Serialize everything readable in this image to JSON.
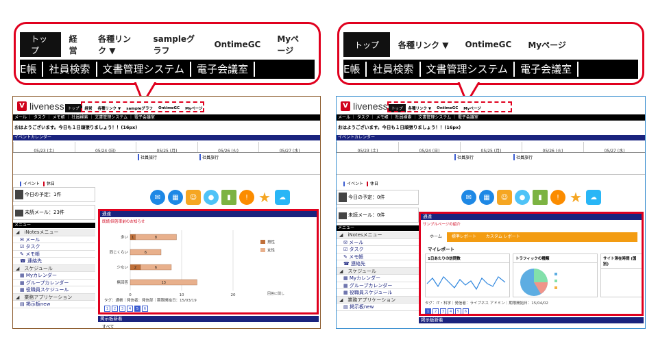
{
  "left_callout": {
    "tabs": [
      "トップ",
      "経営",
      "各種リンク ▼",
      "sampleグラフ",
      "OntimeGC",
      "Myページ"
    ],
    "bar": [
      "E帳",
      "社員検索",
      "文書管理システム",
      "電子会議室"
    ]
  },
  "right_callout": {
    "tabs": [
      "トップ",
      "各種リンク ▼",
      "OntimeGC",
      "Myページ"
    ],
    "bar": [
      "E帳",
      "社員検索",
      "文書管理システム",
      "電子会議室"
    ]
  },
  "shot_left": {
    "logo": "liveness",
    "tabs": [
      "トップ",
      "経営",
      "各種リンク ▼",
      "sampleグラフ",
      "OntimeGC",
      "Myページ"
    ],
    "subbar": "メール ｜ タスク ｜ メモ帳 ｜ 社員検索 ｜ 文書管理システム ｜ 電子会議室",
    "greeting": "おはようございます。今日も１日頑張りましょう！！(16px)",
    "event_band": "イベントカレンダー",
    "dates": [
      "05/23 (土)",
      "05/24 (日)",
      "05/25 (月)",
      "05/26 (火)",
      "05/27 (水)"
    ],
    "events": [
      "社員旅行",
      "社員旅行"
    ],
    "legend": [
      "イベント",
      "休日"
    ],
    "todo": "今日の予定：1件",
    "mail": "未読メール：23件",
    "menu_head": "メニュー",
    "menu": [
      {
        "t": "◢　iNotesメニュー",
        "k": "grp"
      },
      {
        "t": "✉ メール",
        "k": "lnk"
      },
      {
        "t": "☑ タスク",
        "k": "lnk"
      },
      {
        "t": "✎ メモ帳",
        "k": "lnk"
      },
      {
        "t": "☎ 連絡先",
        "k": "lnk"
      },
      {
        "t": "◢　スケジュール",
        "k": "grp"
      },
      {
        "t": "▦ Myカレンダー",
        "k": "lnk"
      },
      {
        "t": "▦ グループカレンダー",
        "k": "lnk"
      },
      {
        "t": "▦ 役職員スケジュール",
        "k": "lnk"
      },
      {
        "t": "◢　業務アプリケーション",
        "k": "grp"
      },
      {
        "t": "▤ 掲示板new",
        "k": "lnk"
      }
    ],
    "panel_title": "通達",
    "panel_sub": "既読/回答率前のお知らせ",
    "panel_foot": "タグ：通帳｜発信者：発信部｜期限開始日：15/03/19",
    "pager": [
      "1",
      "2",
      "3",
      "4",
      "5",
      "6"
    ],
    "bottom_band": "掲示板新着",
    "bottom_item": "すべて"
  },
  "shot_right": {
    "logo": "liveness",
    "tabs": [
      "トップ",
      "各種リンク ▼",
      "OntimeGC",
      "Myページ"
    ],
    "subbar": "メール ｜ タスク ｜ メモ帳 ｜ 社員検索 ｜ 文書管理システム ｜ 電子会議室",
    "greeting": "おはようございます。今日も１日頑張りましょう！！(16px)",
    "event_band": "イベントカレンダー",
    "dates": [
      "05/23 (土)",
      "05/24 (日)",
      "05/25 (月)",
      "05/26 (火)",
      "05/27 (水)"
    ],
    "events": [
      "社員旅行",
      "社員旅行"
    ],
    "legend": [
      "イベント",
      "休日"
    ],
    "todo": "今日の予定：0件",
    "mail": "未読メール：0件",
    "menu_head": "メニュー",
    "menu": [
      {
        "t": "◢　iNotesメニュー",
        "k": "grp"
      },
      {
        "t": "✉ メール",
        "k": "lnk"
      },
      {
        "t": "☑ タスク",
        "k": "lnk"
      },
      {
        "t": "✎ メモ帳",
        "k": "lnk"
      },
      {
        "t": "☎ 連絡先",
        "k": "lnk"
      },
      {
        "t": "◢　スケジュール",
        "k": "grp"
      },
      {
        "t": "▦ Myカレンダー",
        "k": "lnk"
      },
      {
        "t": "▦ グループカレンダー",
        "k": "lnk"
      },
      {
        "t": "▦ 役職員スケジュール",
        "k": "lnk"
      },
      {
        "t": "◢　業務アプリケーション",
        "k": "grp"
      },
      {
        "t": "▤ 掲示板new",
        "k": "lnk"
      }
    ],
    "panel_title": "通達",
    "panel_sub": "サンプルページの紹介",
    "orange_tabs": [
      "ホーム",
      "標準レポート",
      "カスタム レポート"
    ],
    "report_title": "マイレポート",
    "boxes": [
      "1日あたりの訪問数",
      "トラフィックの種類",
      "サイト滞在時間 (国別)"
    ],
    "panel_foot": "タグ：IT・科学｜発信者：ライブネス アドミン｜期限開始日：15/04/02",
    "pager": [
      "1",
      "2",
      "3",
      "4",
      "5",
      "6"
    ],
    "bottom_band": "掲示板新着"
  },
  "left_chart": {
    "type": "bar",
    "categories": [
      "多い",
      "同じくらい",
      "少ない",
      "無回答"
    ],
    "series": [
      {
        "name": "男性",
        "values": [
          1,
          0,
          2,
          0
        ]
      },
      {
        "name": "女性",
        "values": [
          8,
          6,
          6,
          13
        ]
      }
    ],
    "extra_labels": [
      "1",
      "8",
      "6",
      "3",
      "2",
      "6",
      "13",
      "2"
    ],
    "xticks": [
      "0",
      "10",
      "20"
    ],
    "note": "回答に関し"
  },
  "colors": {
    "accent_red": "#e0001e",
    "navy": "#1a237e",
    "orange": "#f39c12",
    "bar_tan": "#e0a080"
  }
}
